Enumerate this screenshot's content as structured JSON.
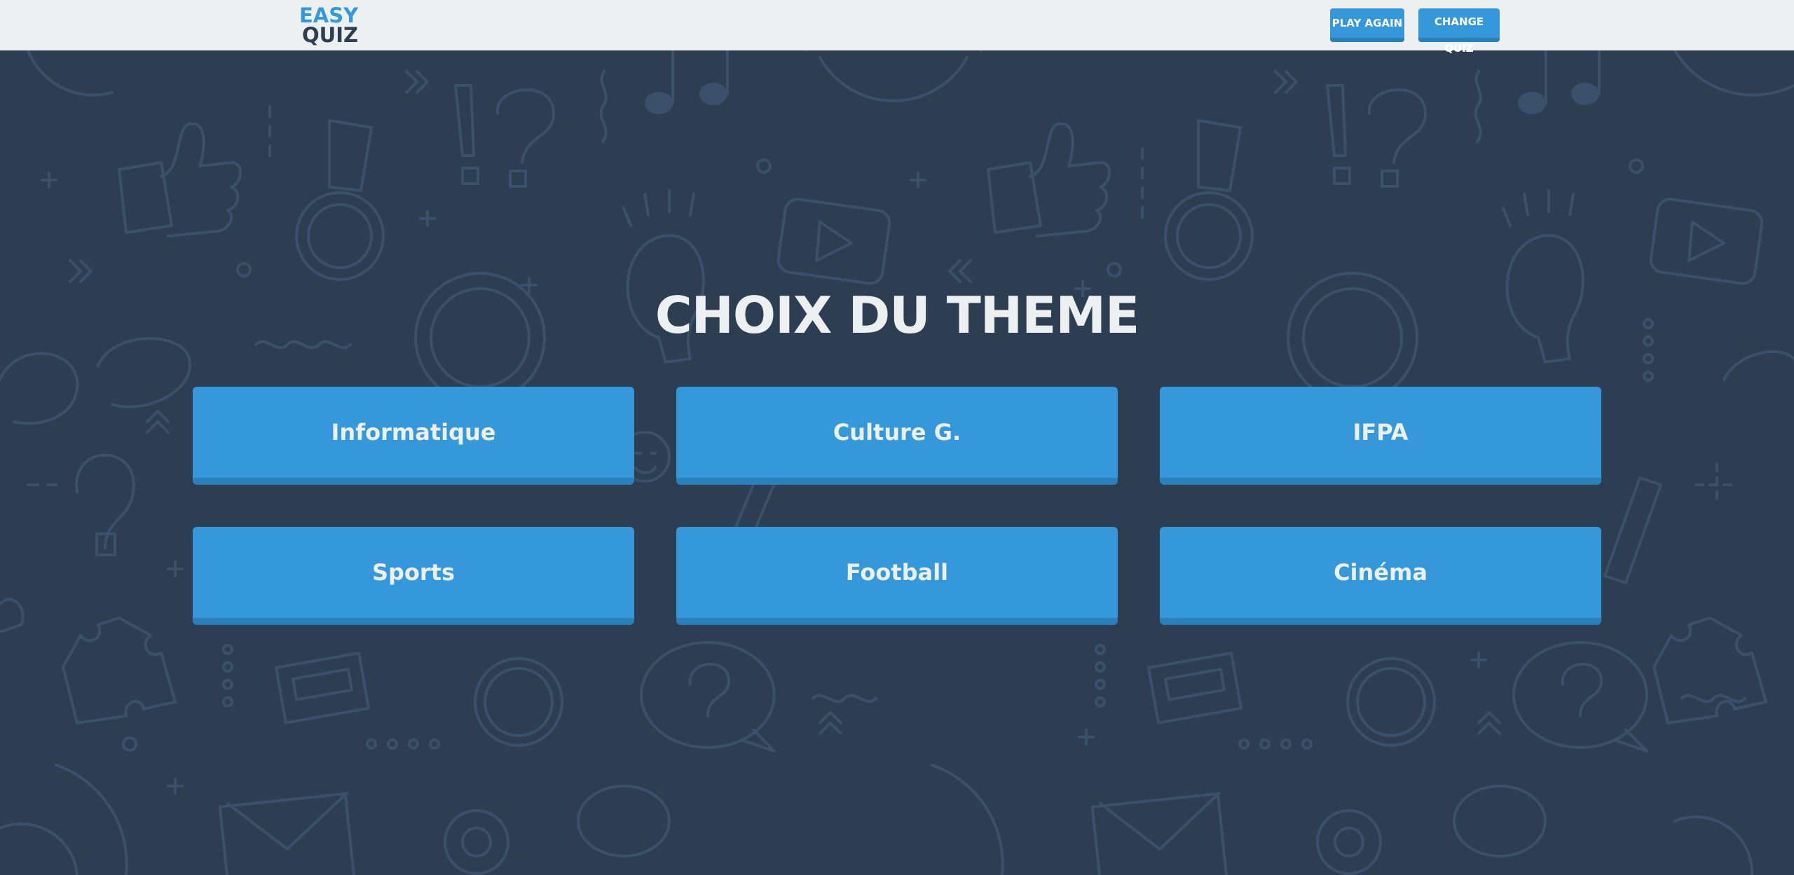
{
  "logo": {
    "line1": "EASY",
    "line2": "QUIZ"
  },
  "nav": {
    "play_again_label": "PLAY AGAIN",
    "change_quiz_label": "CHANGE QUIZ"
  },
  "title": "CHOIX DU THEME",
  "themes": [
    {
      "label": "Informatique"
    },
    {
      "label": "Culture G."
    },
    {
      "label": "IFPA"
    },
    {
      "label": "Sports"
    },
    {
      "label": "Football"
    },
    {
      "label": "Cinéma"
    }
  ],
  "colors": {
    "navbar_bg": "#ecf0f1",
    "page_bg": "#2e3e52",
    "button_blue": "#3498db",
    "button_shadow": "#2a80b9",
    "title_text": "#ecf0f1",
    "logo_dark": "#2c3e50",
    "doodle_stroke": "#3b516b"
  },
  "icons": [
    "question-mark-icon",
    "lightbulb-icon",
    "medal-icon",
    "thumbs-up-icon",
    "play-video-icon",
    "globe-icon",
    "puzzle-icon",
    "music-note-icon",
    "glasses-icon",
    "pencil-icon",
    "gear-icon",
    "envelope-icon",
    "speech-bubble-icon"
  ]
}
